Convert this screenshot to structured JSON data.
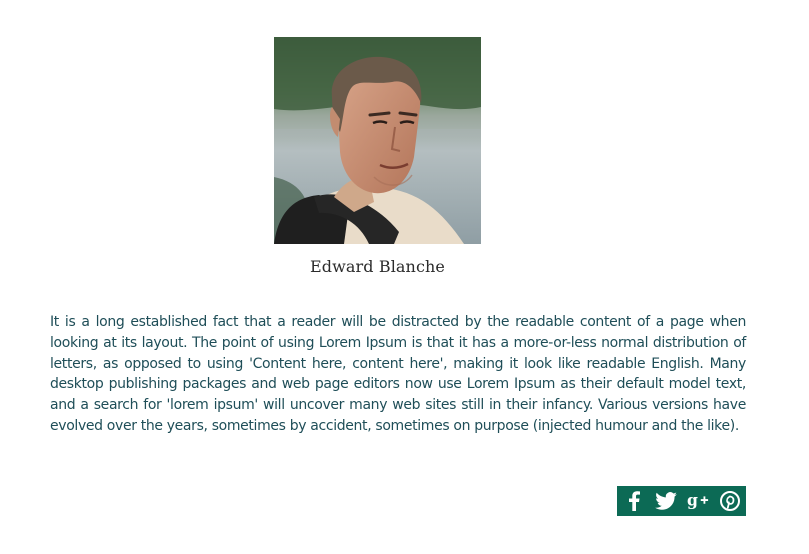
{
  "profile": {
    "name": "Edward Blanche",
    "photo_alt": "Edward Blanche",
    "bio": "It is a long established fact that a reader will be distracted by the readable content of a page when looking at its layout. The point of using Lorem Ipsum is that it has a more-or-less normal distribution of letters, as opposed to using 'Content here, content here', making it look like readable English. Many desktop publishing packages and web page editors now use Lorem Ipsum as their default model text, and a search for 'lorem ipsum' will uncover many web sites still in their infancy. Various versions have evolved over the years, sometimes by accident, sometimes on purpose (injected humour and the like)."
  },
  "social": {
    "bar_color": "#0c6a55",
    "icons": [
      "facebook-icon",
      "twitter-icon",
      "google-plus-icon",
      "pinterest-icon"
    ]
  }
}
